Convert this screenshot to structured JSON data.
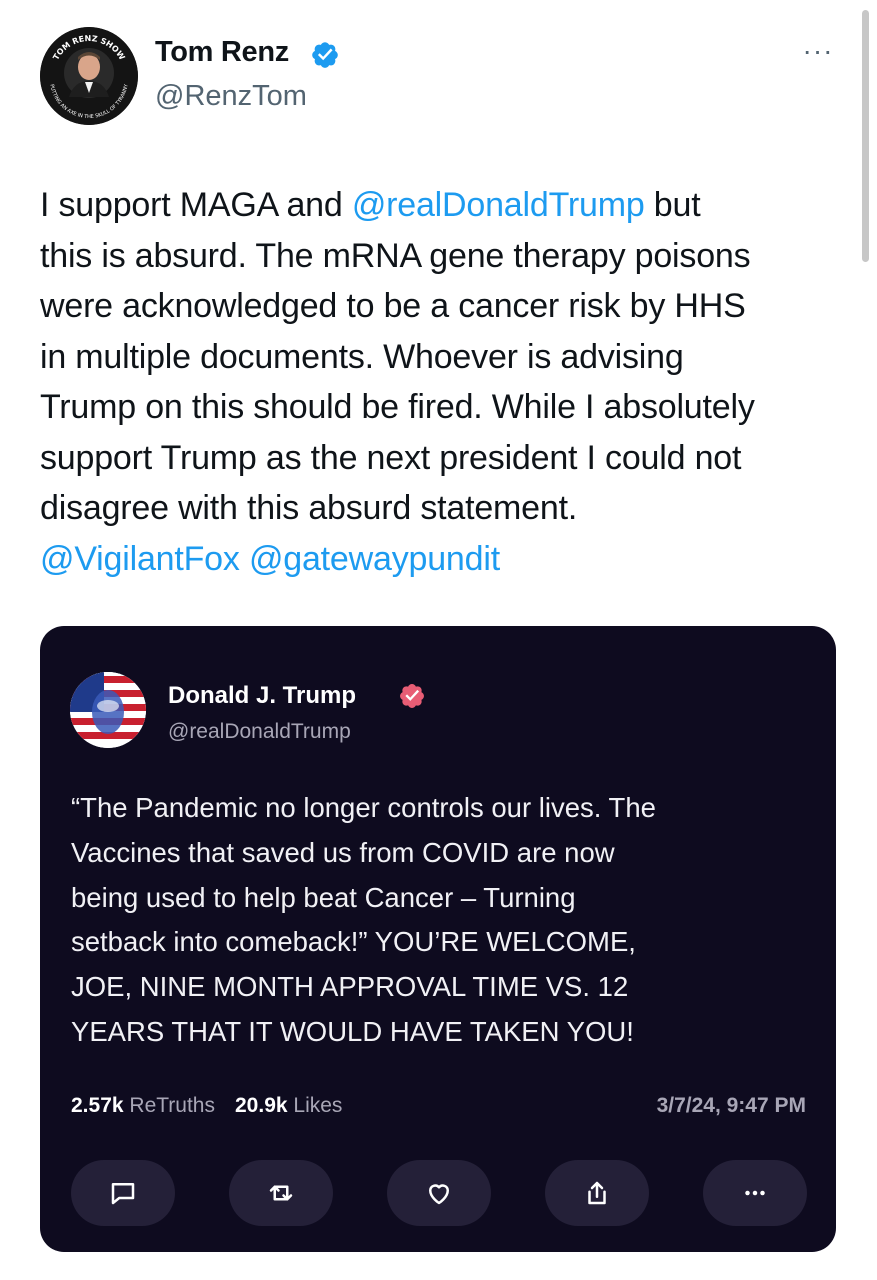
{
  "tweet": {
    "author": {
      "display_name": "Tom Renz",
      "handle": "@RenzTom",
      "verified": true,
      "avatar_ring_text": "TOM RENZ SHOW",
      "avatar_ring_subtext": "PUTTING AN AXE IN THE SKULL OF TYRANNY"
    },
    "more_label": "···",
    "text_lines": [
      {
        "before": "I support MAGA and ",
        "mention": "@realDonaldTrump",
        "after": " but"
      },
      {
        "text": "this is absurd. The mRNA gene therapy poisons"
      },
      {
        "text": "were acknowledged to be a cancer risk by HHS"
      },
      {
        "text": "in multiple documents. Whoever is advising"
      },
      {
        "text": "Trump on this should be fired. While I absolutely"
      },
      {
        "text": "support Trump as the next president I could not"
      },
      {
        "text": "disagree with this absurd statement."
      }
    ],
    "mentions_line": {
      "first": "@VigilantFox",
      "second": "@gatewaypundit"
    }
  },
  "embedded_post": {
    "author": {
      "display_name": "Donald J. Trump",
      "handle": "@realDonaldTrump",
      "verified": true
    },
    "text_lines": [
      "“The Pandemic no longer controls our lives. The",
      "Vaccines that saved us from COVID are now",
      "being used to help beat Cancer – Turning",
      "setback into comeback!” YOU’RE WELCOME,",
      "JOE, NINE MONTH APPROVAL TIME VS. 12",
      "YEARS THAT IT WOULD HAVE TAKEN YOU!"
    ],
    "stats": {
      "retruths_count": "2.57k",
      "retruths_label": "ReTruths",
      "likes_count": "20.9k",
      "likes_label": "Likes"
    },
    "timestamp": "3/7/24, 9:47 PM",
    "actions": [
      "reply-icon",
      "retruth-icon",
      "like-icon",
      "share-icon",
      "more-icon"
    ]
  },
  "colors": {
    "link": "#1d9bf0",
    "verified_blue": "#1d9bf0",
    "embed_bg": "#0e0b1f",
    "embed_button_bg": "#242038",
    "truth_badge": "#e85d75"
  }
}
